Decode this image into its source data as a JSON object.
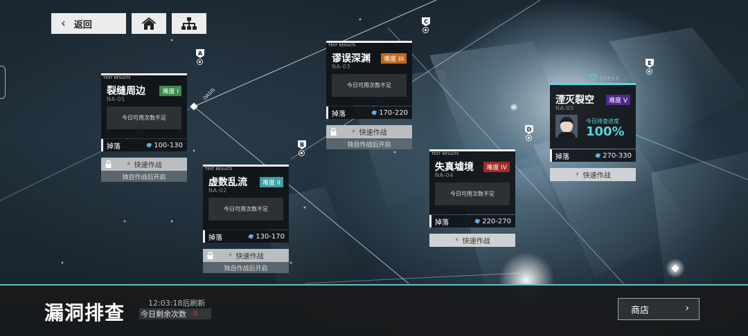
{
  "topbar": {
    "back_label": "返回",
    "home_icon": "home-icon",
    "map_icon": "map-icon"
  },
  "nodes": [
    "A",
    "B",
    "C",
    "D",
    "E"
  ],
  "decor": {
    "oasis_text": "OASIS",
    "stage_text": "STAGE"
  },
  "common": {
    "test_results": "TEST RESULTS",
    "insufficient": "今日可用次数不足",
    "drop_label": "掉落",
    "quick_battle": "快速作战",
    "solo_unlock": "独自作战后开启"
  },
  "cards": [
    {
      "title": "裂缝周边",
      "code": "NA-01",
      "difficulty": "难度 I",
      "diff_color": "#3d8a4a",
      "drop_range": "100-130"
    },
    {
      "title": "虚数乱流",
      "code": "NA-02",
      "difficulty": "难度 II",
      "diff_color": "#3ea0a2",
      "drop_range": "130-170"
    },
    {
      "title": "谬误深渊",
      "code": "NA-03",
      "difficulty": "难度 III",
      "diff_color": "#c46a1d",
      "drop_range": "170-220"
    },
    {
      "title": "失真墟境",
      "code": "NA-04",
      "difficulty": "难度 IV",
      "diff_color": "#a12b2b",
      "drop_range": "220-270"
    },
    {
      "title": "湮灭裂空",
      "code": "NA-05",
      "difficulty": "难度 V",
      "diff_color": "#4f2a8a",
      "drop_range": "270-330",
      "progress_label": "今日排查进度",
      "progress_value": "100%"
    }
  ],
  "bottom": {
    "title": "漏洞排查",
    "refresh": "12:03:18后刷新",
    "remaining_label": "今日剩余次数",
    "remaining_count": "0",
    "shop_label": "商店",
    "shop_arrow": "›"
  },
  "colors": {
    "accent": "#58c6cc",
    "highlight": "#54d9dd",
    "warning": "#e43a3a"
  }
}
